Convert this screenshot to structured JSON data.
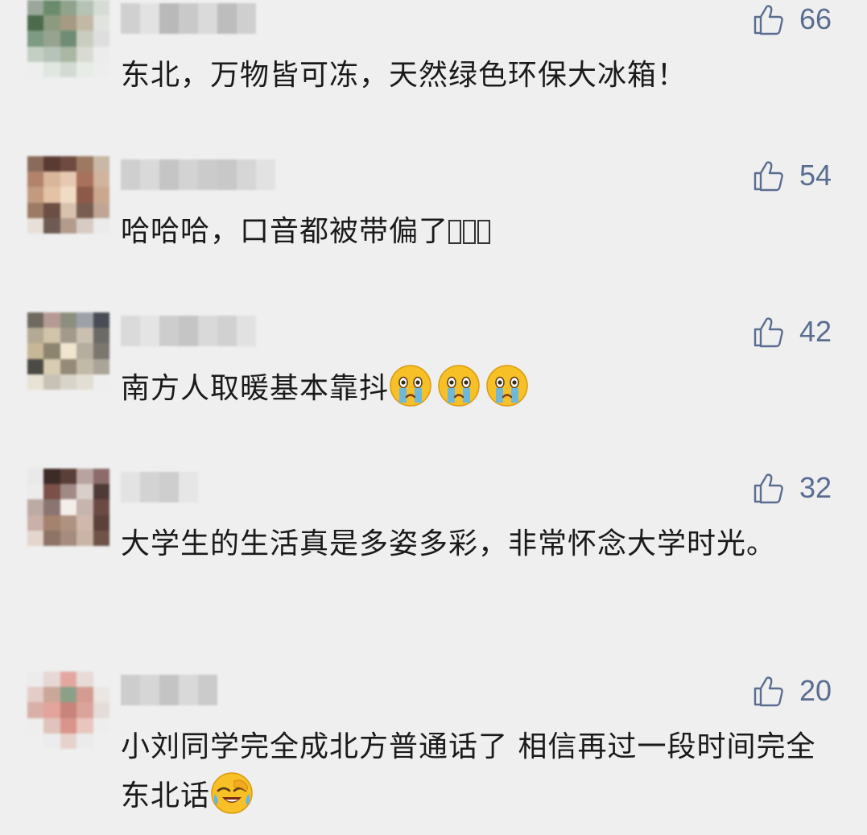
{
  "colors": {
    "background": "#efefef",
    "like": "#5a6d91",
    "text": "#1a1a1a"
  },
  "comments": [
    {
      "likes": "66",
      "text": "东北，万物皆可冻，天然绿色环保大冰箱！",
      "avatar_colors": [
        "#9aa79a",
        "#6b8c6c",
        "#8fa38d",
        "#b5c3b4",
        "#d5dcd4",
        "#4c6b4d",
        "#8c9b7f",
        "#a79a82",
        "#c1b9a4",
        "#e1e4de",
        "#7d9a82",
        "#95a48f",
        "#6f8d75",
        "#c9cdbf",
        "#dedede",
        "#c4cfc3",
        "#b6c3b9",
        "#a9b7a3",
        "#d9dbd2",
        "#ececec",
        "#eeeeee",
        "#e0e6e0",
        "#d3dad3",
        "#e8ece6",
        "#ededed"
      ],
      "nickname_colors": [
        "#d0d0d0",
        "#e2e2e2",
        "#b9b9b9",
        "#c9c9c9",
        "#dadada",
        "#bdbdbd",
        "#cfcfcf"
      ]
    },
    {
      "likes": "54",
      "text": "哈哈哈，口音都被带偏了",
      "trailing_glyphs": [
        "missing-glyph",
        "missing-glyph",
        "missing-glyph"
      ],
      "avatar_colors": [
        "#8a6b5b",
        "#5a3b34",
        "#6e4a40",
        "#9c7a62",
        "#c8b8a5",
        "#b2826a",
        "#d9b59b",
        "#e7c9b3",
        "#a8715b",
        "#d0b49e",
        "#c29a7e",
        "#e3c2a6",
        "#f0dcc4",
        "#8c5a48",
        "#c9a88e",
        "#9c7a64",
        "#6b4e44",
        "#d8c2ae",
        "#7a5d52",
        "#bfa694",
        "#e8e0d8",
        "#6e5b54",
        "#b49c8c",
        "#d6ccc4",
        "#ebebeb"
      ],
      "nickname_colors": [
        "#cfcfcf",
        "#d9d9d9",
        "#c5c5c5",
        "#d3d3d3",
        "#cbcbcb",
        "#c8c8c8",
        "#d6d6d6",
        "#e2e2e2"
      ]
    },
    {
      "likes": "42",
      "text": "南方人取暖基本靠抖",
      "emojis": [
        "crying-face-emoji",
        "crying-face-emoji",
        "crying-face-emoji"
      ],
      "avatar_colors": [
        "#6e6a60",
        "#b59a94",
        "#8c8f7e",
        "#9da1a8",
        "#4a4c55",
        "#b4a994",
        "#d1c4a8",
        "#a49a8c",
        "#c9c0b0",
        "#6c6a66",
        "#c6b796",
        "#8c846e",
        "#f0e6cf",
        "#b5ae9e",
        "#7b766e",
        "#4c4a44",
        "#d8ccb2",
        "#958a78",
        "#c2baa8",
        "#aba498",
        "#e8e2d4",
        "#c8c2b6",
        "#d9d4c9",
        "#e3ded4",
        "#eeeeee"
      ],
      "nickname_colors": [
        "#dadada",
        "#e4e4e4",
        "#cdcdcd",
        "#c5c5c5",
        "#d9d9d9",
        "#d1d1d1",
        "#e1e1e1"
      ]
    },
    {
      "likes": "32",
      "text": "大学生的生活真是多姿多彩，非常怀念大学时光。",
      "avatar_colors": [
        "#e9e9e9",
        "#3d2b28",
        "#5a3e38",
        "#b8a3a0",
        "#8c6c6a",
        "#ececec",
        "#7a5048",
        "#a08a86",
        "#d8cfca",
        "#4e3b38",
        "#bcaaa4",
        "#8a7570",
        "#f4eeea",
        "#c6b4ae",
        "#6b4a44",
        "#c9b0a8",
        "#a4826e",
        "#b09280",
        "#d1b8ac",
        "#5a423a",
        "#e4d6cc",
        "#8e7466",
        "#a58c7e",
        "#cab4a6",
        "#6e5448"
      ],
      "nickname_colors": [
        "#e3e3e3",
        "#d3d3d3",
        "#cecece",
        "#e6e6e6"
      ]
    },
    {
      "likes": "20",
      "text": "小刘同学完全成北方普通话了 相信再过一段时间完全东北话",
      "emojis": [
        "laughing-crying-face-emoji"
      ],
      "avatar_colors": [
        "#ececec",
        "#e6d8d4",
        "#e2a8a0",
        "#e8dcd8",
        "#efefef",
        "#e4cdc6",
        "#c9a89a",
        "#8ca088",
        "#d49c90",
        "#ebe6e2",
        "#d8b0a8",
        "#e2a49c",
        "#c8847a",
        "#dba49a",
        "#e4dcd8",
        "#eeeeee",
        "#e0c4bc",
        "#d9958c",
        "#e8c6be",
        "#ededed",
        "#efefef",
        "#ececec",
        "#e6d2cc",
        "#ebebeb",
        "#efefef"
      ],
      "nickname_colors": [
        "#cdcdcd",
        "#d6d6d6",
        "#c4c4c4",
        "#d9d9d9",
        "#cbcbcb"
      ]
    }
  ]
}
